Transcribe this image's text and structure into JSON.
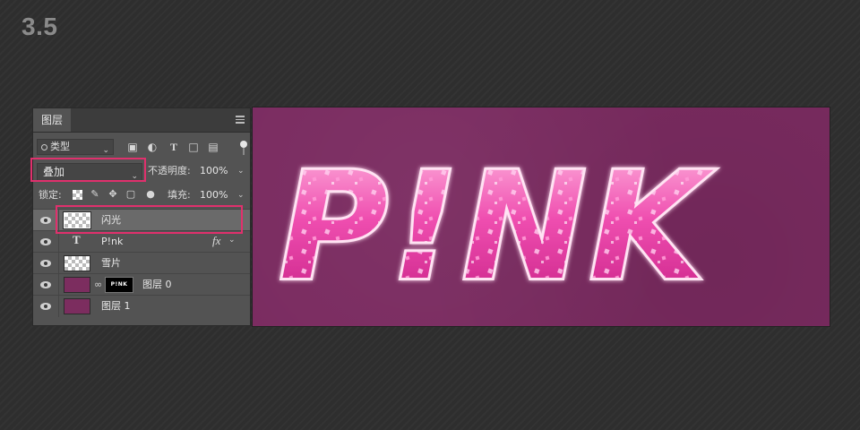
{
  "step_label": "3.5",
  "panel": {
    "tab_label": "图层",
    "filter": {
      "label": "类型",
      "icons": [
        "image-filter-icon",
        "adjustment-filter-icon",
        "type-filter-icon",
        "shape-filter-icon",
        "smart-object-filter-icon"
      ]
    },
    "blend": {
      "mode": "叠加",
      "opacity_label": "不透明度:",
      "opacity_value": "100%"
    },
    "lock": {
      "label": "锁定:",
      "fill_label": "填充:",
      "fill_value": "100%"
    },
    "layers": [
      {
        "name": "闪光",
        "kind": "pixel",
        "selected": true
      },
      {
        "name": "P!nk",
        "kind": "text",
        "has_fx": true,
        "fx_label": "fx"
      },
      {
        "name": "雪片",
        "kind": "pixel"
      },
      {
        "name": "图层 0",
        "kind": "pixel-with-mask",
        "mask_text": "P!NK"
      },
      {
        "name": "图层 1",
        "kind": "pixel"
      }
    ]
  },
  "canvas": {
    "artwork_text": "P!NK",
    "background_color": "#7a2b60",
    "text_color": "#e94aa8",
    "highlight_color": "#e0306d"
  }
}
